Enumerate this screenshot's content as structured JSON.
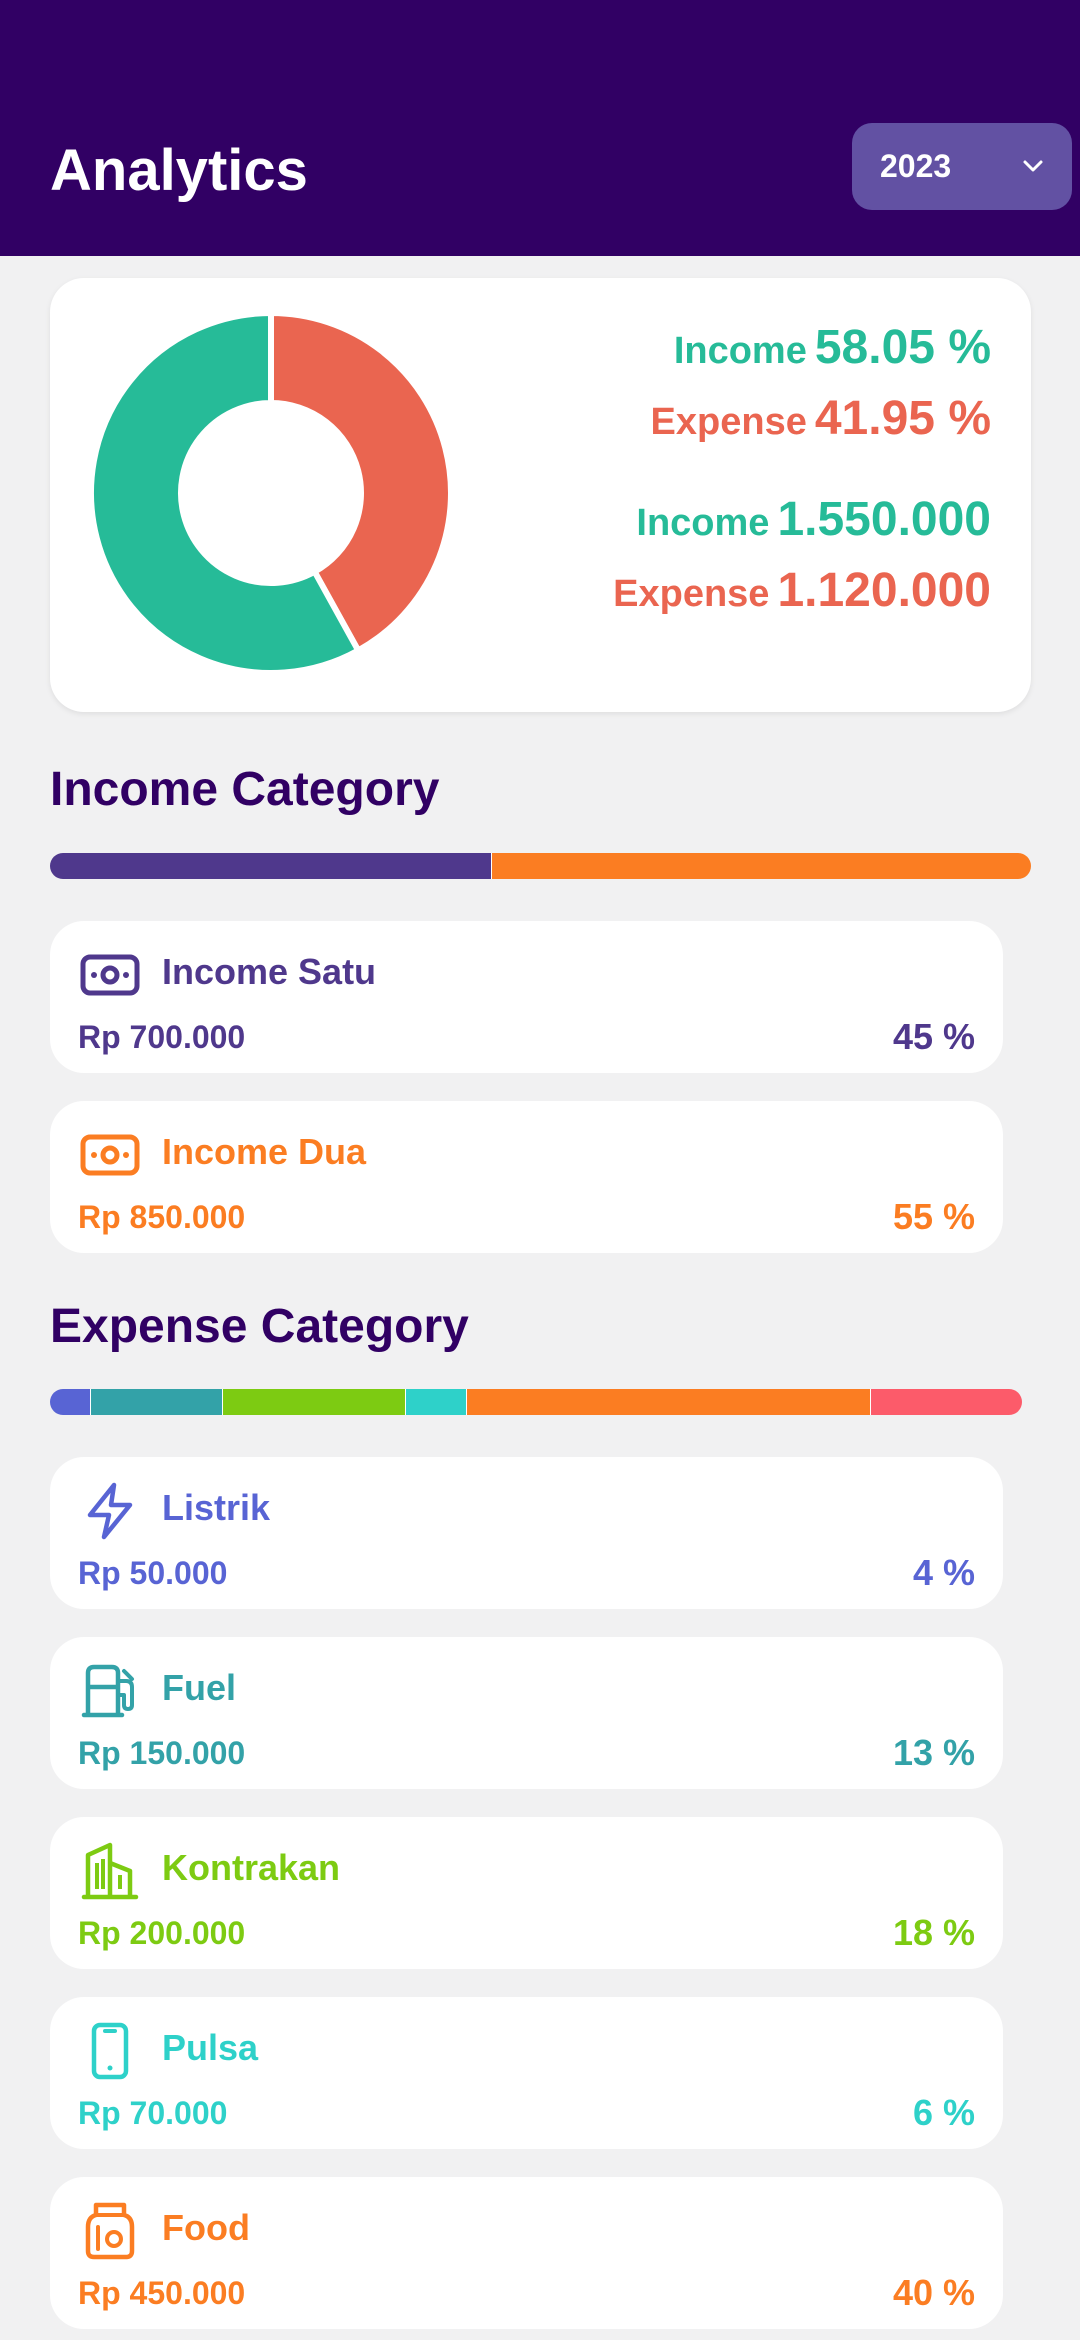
{
  "header": {
    "title": "Analytics",
    "year": "2023",
    "background": "#310064"
  },
  "summary": {
    "chart_data": {
      "type": "pie",
      "donut": true,
      "categories": [
        "Income",
        "Expense"
      ],
      "values": [
        58.05,
        41.95
      ],
      "colors": [
        "#26bb98",
        "#ea6550"
      ]
    },
    "income_pct_label": "Income",
    "income_pct_value": "58.05 %",
    "expense_pct_label": "Expense",
    "expense_pct_value": "41.95 %",
    "income_amt_label": "Income",
    "income_amt_value": "1.550.000",
    "expense_amt_label": "Expense",
    "expense_amt_value": "1.120.000",
    "income_color": "#26bb98",
    "expense_color": "#ea6550"
  },
  "income_category": {
    "title": "Income Category",
    "items": [
      {
        "name": "Income Satu",
        "amount": "Rp 700.000",
        "pct": "45 %",
        "share": 45,
        "color": "#4f388c",
        "icon": "money-icon"
      },
      {
        "name": "Income Dua",
        "amount": "Rp 850.000",
        "pct": "55 %",
        "share": 55,
        "color": "#fb7d22",
        "icon": "money-icon"
      }
    ]
  },
  "expense_category": {
    "title": "Expense Category",
    "items": [
      {
        "name": "Listrik",
        "amount": "Rp 50.000",
        "pct": "4 %",
        "share": 4,
        "color": "#5864d4",
        "icon": "lightning-icon"
      },
      {
        "name": "Fuel",
        "amount": "Rp 150.000",
        "pct": "13 %",
        "share": 13,
        "color": "#33a2a8",
        "icon": "fuel-pump-icon"
      },
      {
        "name": "Kontrakan",
        "amount": "Rp 200.000",
        "pct": "18 %",
        "share": 18,
        "color": "#7dcb12",
        "icon": "building-icon"
      },
      {
        "name": "Pulsa",
        "amount": "Rp 70.000",
        "pct": "6 %",
        "share": 6,
        "color": "#2ed1c9",
        "icon": "phone-icon"
      },
      {
        "name": "Food",
        "amount": "Rp 450.000",
        "pct": "40 %",
        "share": 40,
        "color": "#fb7d22",
        "icon": "food-bag-icon"
      },
      {
        "name": "",
        "amount": "",
        "pct": "",
        "share": 15,
        "color": "#fc5b6a",
        "icon": ""
      }
    ]
  }
}
